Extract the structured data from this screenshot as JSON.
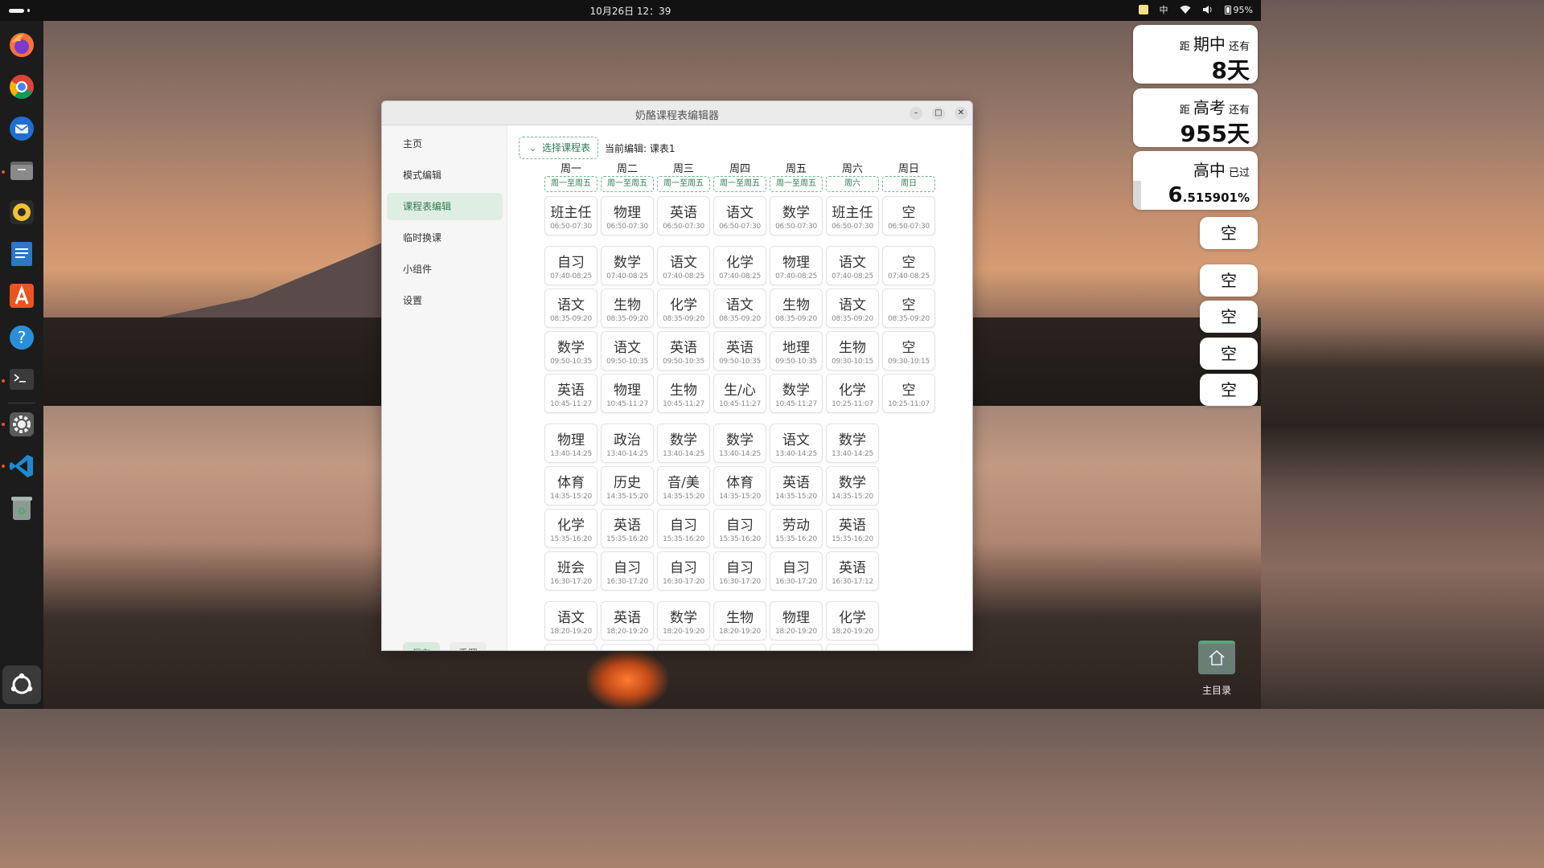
{
  "topbar": {
    "clock": "10月26日  12：39",
    "ime": "中",
    "battery": "95%"
  },
  "dock": {
    "items": [
      "firefox-icon",
      "chrome-icon",
      "thunderbird-icon",
      "files-icon",
      "rhythmbox-icon",
      "writer-icon",
      "app-center-icon",
      "help-icon",
      "terminal-icon",
      "settings-icon",
      "vscode-icon",
      "trash-icon"
    ]
  },
  "window": {
    "title": "奶酪课程表编辑器",
    "sidebar": {
      "items": [
        {
          "label": "主页"
        },
        {
          "label": "模式编辑"
        },
        {
          "label": "课程表编辑"
        },
        {
          "label": "临时换课"
        },
        {
          "label": "小组件"
        },
        {
          "label": "设置"
        }
      ],
      "save": "保存",
      "reset": "重置"
    },
    "editor": {
      "select_label": "选择课程表",
      "current_prefix": "当前编辑:",
      "current_value": "课表1",
      "days": [
        "周一",
        "周二",
        "周三",
        "周四",
        "周五",
        "周六",
        "周日"
      ],
      "modes": [
        "周一至周五",
        "周一至周五",
        "周一至周五",
        "周一至周五",
        "周一至周五",
        "周六",
        "周日"
      ],
      "rows": [
        [
          [
            "班主任",
            "06:50-07:30"
          ],
          [
            "物理",
            "06:50-07:30"
          ],
          [
            "英语",
            "06:50-07:30"
          ],
          [
            "语文",
            "06:50-07:30"
          ],
          [
            "数学",
            "06:50-07:30"
          ],
          [
            "班主任",
            "06:50-07:30"
          ],
          [
            "空",
            "06:50-07:30"
          ]
        ],
        [
          [
            "自习",
            "07:40-08:25"
          ],
          [
            "数学",
            "07:40-08:25"
          ],
          [
            "语文",
            "07:40-08:25"
          ],
          [
            "化学",
            "07:40-08:25"
          ],
          [
            "物理",
            "07:40-08:25"
          ],
          [
            "语文",
            "07:40-08:25"
          ],
          [
            "空",
            "07:40-08:25"
          ]
        ],
        [
          [
            "语文",
            "08:35-09:20"
          ],
          [
            "生物",
            "08:35-09:20"
          ],
          [
            "化学",
            "08:35-09:20"
          ],
          [
            "语文",
            "08:35-09:20"
          ],
          [
            "生物",
            "08:35-09:20"
          ],
          [
            "语文",
            "08:35-09:20"
          ],
          [
            "空",
            "08:35-09:20"
          ]
        ],
        [
          [
            "数学",
            "09:50-10:35"
          ],
          [
            "语文",
            "09:50-10:35"
          ],
          [
            "英语",
            "09:50-10:35"
          ],
          [
            "英语",
            "09:50-10:35"
          ],
          [
            "地理",
            "09:50-10:35"
          ],
          [
            "生物",
            "09:30-10:15"
          ],
          [
            "空",
            "09:30-10:15"
          ]
        ],
        [
          [
            "英语",
            "10:45-11:27"
          ],
          [
            "物理",
            "10:45-11:27"
          ],
          [
            "生物",
            "10:45-11:27"
          ],
          [
            "生/心",
            "10:45-11:27"
          ],
          [
            "数学",
            "10:45-11:27"
          ],
          [
            "化学",
            "10:25-11:07"
          ],
          [
            "空",
            "10:25-11:07"
          ]
        ],
        [
          [
            "物理",
            "13:40-14:25"
          ],
          [
            "政治",
            "13:40-14:25"
          ],
          [
            "数学",
            "13:40-14:25"
          ],
          [
            "数学",
            "13:40-14:25"
          ],
          [
            "语文",
            "13:40-14:25"
          ],
          [
            "数学",
            "13:40-14:25"
          ]
        ],
        [
          [
            "体育",
            "14:35-15:20"
          ],
          [
            "历史",
            "14:35-15:20"
          ],
          [
            "音/美",
            "14:35-15:20"
          ],
          [
            "体育",
            "14:35-15:20"
          ],
          [
            "英语",
            "14:35-15:20"
          ],
          [
            "数学",
            "14:35-15:20"
          ]
        ],
        [
          [
            "化学",
            "15:35-16:20"
          ],
          [
            "英语",
            "15:35-16:20"
          ],
          [
            "自习",
            "15:35-16:20"
          ],
          [
            "自习",
            "15:35-16:20"
          ],
          [
            "劳动",
            "15:35-16:20"
          ],
          [
            "英语",
            "15:35-16:20"
          ]
        ],
        [
          [
            "班会",
            "16:30-17:20"
          ],
          [
            "自习",
            "16:30-17:20"
          ],
          [
            "自习",
            "16:30-17:20"
          ],
          [
            "自习",
            "16:30-17:20"
          ],
          [
            "自习",
            "16:30-17:20"
          ],
          [
            "英语",
            "16:30-17:12"
          ]
        ],
        [
          [
            "语文",
            "18:20-19:20"
          ],
          [
            "英语",
            "18:20-19:20"
          ],
          [
            "数学",
            "18:20-19:20"
          ],
          [
            "生物",
            "18:20-19:20"
          ],
          [
            "物理",
            "18:20-19:20"
          ],
          [
            "化学",
            "18:20-19:20"
          ]
        ]
      ]
    }
  },
  "widgets": {
    "midterm": {
      "prefix": "距",
      "event": "期中",
      "suffix": "还有",
      "value": "8天"
    },
    "gaokao": {
      "prefix": "",
      "event": "高考",
      "suffix": "还有",
      "value": "955天",
      "prefix_text": "距"
    },
    "highschool": {
      "event": "高中",
      "suffix": "已过",
      "pct_lead": "6",
      "pct_rest": ".515901%",
      "progress": 0.0652
    },
    "slots": [
      "空",
      "空",
      "空",
      "空",
      "空"
    ]
  },
  "desktop": {
    "home_label": "主目录"
  }
}
